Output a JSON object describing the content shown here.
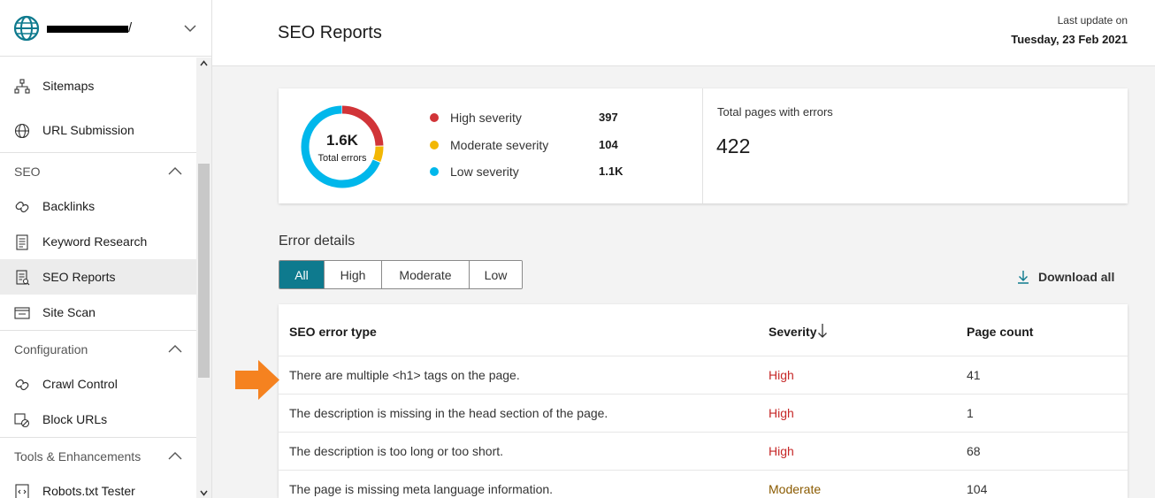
{
  "site": {
    "name_suffix": "/"
  },
  "sidebar": {
    "items": [
      {
        "label": "Sitemaps"
      },
      {
        "label": "URL Submission"
      },
      {
        "label": "Backlinks"
      },
      {
        "label": "Keyword Research"
      },
      {
        "label": "SEO Reports"
      },
      {
        "label": "Site Scan"
      },
      {
        "label": "Crawl Control"
      },
      {
        "label": "Block URLs"
      },
      {
        "label": "Robots.txt Tester"
      }
    ],
    "sections": [
      {
        "label": "SEO"
      },
      {
        "label": "Configuration"
      },
      {
        "label": "Tools & Enhancements"
      }
    ]
  },
  "header": {
    "title": "SEO Reports",
    "last_update_label": "Last update on",
    "last_update_value": "Tuesday, 23 Feb 2021"
  },
  "summary": {
    "total_value": "1.6K",
    "total_label": "Total errors",
    "severities": [
      {
        "name": "High severity",
        "value": "397",
        "color": "#d13438"
      },
      {
        "name": "Moderate severity",
        "value": "104",
        "color": "#f2b705"
      },
      {
        "name": "Low severity",
        "value": "1.1K",
        "color": "#00b7eb"
      }
    ],
    "pages_label": "Total pages with errors",
    "pages_value": "422"
  },
  "error_details": {
    "title": "Error details",
    "filters": [
      "All",
      "High",
      "Moderate",
      "Low"
    ],
    "active_filter": "All",
    "download_label": "Download all",
    "columns": [
      "SEO error type",
      "Severity",
      "Page count"
    ],
    "rows": [
      {
        "type": "There are multiple <h1> tags on the page.",
        "severity": "High",
        "count": "41"
      },
      {
        "type": "The description is missing in the head section of the page.",
        "severity": "High",
        "count": "1"
      },
      {
        "type": "The description is too long or too short.",
        "severity": "High",
        "count": "68"
      },
      {
        "type": "The page is missing meta language information.",
        "severity": "Moderate",
        "count": "104"
      }
    ]
  },
  "colors": {
    "accent": "#0e7a8e",
    "high": "#c62828",
    "moderate": "#8a5a00",
    "arrow": "#f58220"
  }
}
